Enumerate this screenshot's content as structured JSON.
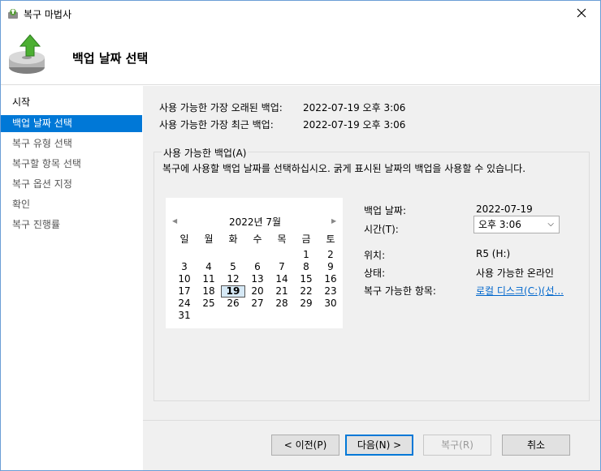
{
  "window": {
    "title": "복구 마법사"
  },
  "header": {
    "title": "백업 날짜 선택"
  },
  "sidebar": {
    "items": [
      {
        "label": "시작"
      },
      {
        "label": "백업 날짜 선택"
      },
      {
        "label": "복구 유형 선택"
      },
      {
        "label": "복구할 항목 선택"
      },
      {
        "label": "복구 옵션 지정"
      },
      {
        "label": "확인"
      },
      {
        "label": "복구 진행률"
      }
    ]
  },
  "info": {
    "oldest_label": "사용 가능한 가장 오래된 백업:",
    "oldest_value": "2022-07-19 오후 3:06",
    "latest_label": "사용 가능한 가장 최근 백업:",
    "latest_value": "2022-07-19 오후 3:06"
  },
  "group": {
    "title": "사용 가능한 백업(A)",
    "description": "복구에 사용할 백업 날짜를 선택하십시오. 굵게 표시된 날짜의 백업을 사용할 수 있습니다."
  },
  "calendar": {
    "month_title": "2022년 7월",
    "weekdays": [
      "일",
      "월",
      "화",
      "수",
      "목",
      "금",
      "토"
    ],
    "weeks": [
      [
        "",
        "",
        "",
        "",
        "",
        "1",
        "2"
      ],
      [
        "3",
        "4",
        "5",
        "6",
        "7",
        "8",
        "9"
      ],
      [
        "10",
        "11",
        "12",
        "13",
        "14",
        "15",
        "16"
      ],
      [
        "17",
        "18",
        "19",
        "20",
        "21",
        "22",
        "23"
      ],
      [
        "24",
        "25",
        "26",
        "27",
        "28",
        "29",
        "30"
      ],
      [
        "31",
        "",
        "",
        "",
        "",
        "",
        ""
      ]
    ],
    "selected_day": "19"
  },
  "details": {
    "date_label": "백업 날짜:",
    "date_value": "2022-07-19",
    "time_label": "시간(T):",
    "time_value": "오후 3:06",
    "location_label": "위치:",
    "location_value": "R5 (H:)",
    "status_label": "상태:",
    "status_value": "사용 가능한 온라인",
    "items_label": "복구 가능한 항목:",
    "items_value": "로컬 디스크(C:)(선..."
  },
  "buttons": {
    "prev": "< 이전(P)",
    "next": "다음(N) >",
    "recover": "복구(R)",
    "cancel": "취소"
  },
  "colors": {
    "accent": "#0078d7",
    "link": "#0066cc",
    "panel_bg": "#f0f0f0"
  }
}
